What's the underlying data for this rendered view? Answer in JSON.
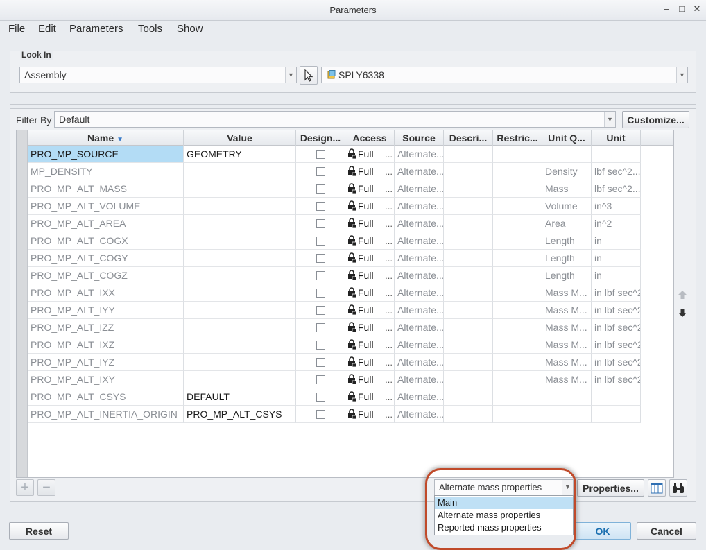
{
  "window": {
    "title": "Parameters",
    "controls": {
      "minimize": "–",
      "maximize": "□",
      "close": "✕"
    }
  },
  "menu": [
    "File",
    "Edit",
    "Parameters",
    "Tools",
    "Show"
  ],
  "look_in": {
    "legend": "Look In",
    "type_value": "Assembly",
    "object_value": "SPLY6338"
  },
  "filter": {
    "label": "Filter By",
    "value": "Default",
    "customize_label": "Customize..."
  },
  "table": {
    "columns": [
      "Name",
      "Value",
      "Design...",
      "Access",
      "Source",
      "Descri...",
      "Restric...",
      "Unit Q...",
      "Unit"
    ],
    "rows": [
      {
        "name": "PRO_MP_SOURCE",
        "value": "GEOMETRY",
        "access": "Full",
        "source": "Alternate...",
        "unit_q": "",
        "unit": ""
      },
      {
        "name": "MP_DENSITY",
        "value": "",
        "access": "Full",
        "source": "Alternate...",
        "unit_q": "Density",
        "unit": "lbf sec^2..."
      },
      {
        "name": "PRO_MP_ALT_MASS",
        "value": "",
        "access": "Full",
        "source": "Alternate...",
        "unit_q": "Mass",
        "unit": "lbf sec^2..."
      },
      {
        "name": "PRO_MP_ALT_VOLUME",
        "value": "",
        "access": "Full",
        "source": "Alternate...",
        "unit_q": "Volume",
        "unit": "in^3"
      },
      {
        "name": "PRO_MP_ALT_AREA",
        "value": "",
        "access": "Full",
        "source": "Alternate...",
        "unit_q": "Area",
        "unit": "in^2"
      },
      {
        "name": "PRO_MP_ALT_COGX",
        "value": "",
        "access": "Full",
        "source": "Alternate...",
        "unit_q": "Length",
        "unit": "in"
      },
      {
        "name": "PRO_MP_ALT_COGY",
        "value": "",
        "access": "Full",
        "source": "Alternate...",
        "unit_q": "Length",
        "unit": "in"
      },
      {
        "name": "PRO_MP_ALT_COGZ",
        "value": "",
        "access": "Full",
        "source": "Alternate...",
        "unit_q": "Length",
        "unit": "in"
      },
      {
        "name": "PRO_MP_ALT_IXX",
        "value": "",
        "access": "Full",
        "source": "Alternate...",
        "unit_q": "Mass M...",
        "unit": "in lbf sec^2"
      },
      {
        "name": "PRO_MP_ALT_IYY",
        "value": "",
        "access": "Full",
        "source": "Alternate...",
        "unit_q": "Mass M...",
        "unit": "in lbf sec^2"
      },
      {
        "name": "PRO_MP_ALT_IZZ",
        "value": "",
        "access": "Full",
        "source": "Alternate...",
        "unit_q": "Mass M...",
        "unit": "in lbf sec^2"
      },
      {
        "name": "PRO_MP_ALT_IXZ",
        "value": "",
        "access": "Full",
        "source": "Alternate...",
        "unit_q": "Mass M...",
        "unit": "in lbf sec^2"
      },
      {
        "name": "PRO_MP_ALT_IYZ",
        "value": "",
        "access": "Full",
        "source": "Alternate...",
        "unit_q": "Mass M...",
        "unit": "in lbf sec^2"
      },
      {
        "name": "PRO_MP_ALT_IXY",
        "value": "",
        "access": "Full",
        "source": "Alternate...",
        "unit_q": "Mass M...",
        "unit": "in lbf sec^2"
      },
      {
        "name": "PRO_MP_ALT_CSYS",
        "value": "DEFAULT",
        "access": "Full",
        "source": "Alternate...",
        "unit_q": "",
        "unit": ""
      },
      {
        "name": "PRO_MP_ALT_INERTIA_ORIGIN",
        "value": "PRO_MP_ALT_CSYS",
        "access": "Full",
        "source": "Alternate...",
        "unit_q": "",
        "unit": ""
      }
    ],
    "access_more": "..."
  },
  "bottom": {
    "add": "+",
    "remove": "−",
    "table_select_value": "Alternate mass properties",
    "table_options": [
      "Main",
      "Alternate mass properties",
      "Reported mass properties"
    ],
    "properties_label": "Properties..."
  },
  "footer": {
    "reset_label": "Reset",
    "ok_label": "OK",
    "cancel_label": "Cancel"
  },
  "colors": {
    "selection": "#b3dcf5",
    "dropdown_selection": "#bfe0f5",
    "highlight_ring": "#c04a2a",
    "ok_text": "#1a6fb0"
  }
}
